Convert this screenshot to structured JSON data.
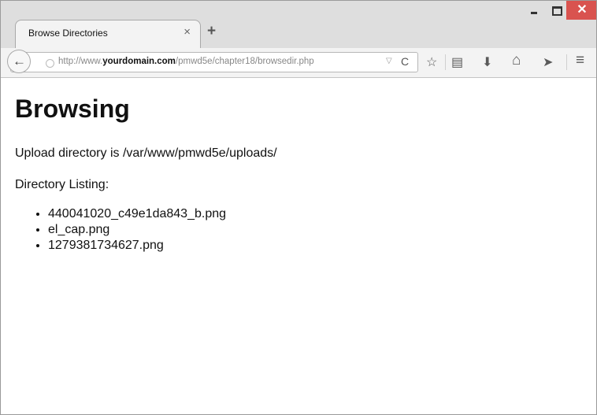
{
  "window": {
    "tab_title": "Browse Directories",
    "tab_close": "×",
    "new_tab": "+",
    "minimize": "–",
    "close": "✕"
  },
  "navbar": {
    "back_glyph": "←",
    "url_prefix": "http://www.",
    "url_domain": "yourdomain.com",
    "url_path": "/pmwd5e/chapter18/browsedir.php",
    "dropdown_glyph": "▽",
    "reload_glyph": "C",
    "icons": [
      "star-icon",
      "clipboard-icon",
      "download-icon",
      "home-icon",
      "share-icon",
      "menu-icon"
    ],
    "icon_glyphs": {
      "star": "☆",
      "clipboard": "▤",
      "download": "⬇",
      "home": "⌂",
      "share": "➤",
      "menu": "≡"
    }
  },
  "page": {
    "heading": "Browsing",
    "upload_line": "Upload directory is /var/www/pmwd5e/uploads/",
    "listing_label": "Directory Listing:",
    "files": [
      "440041020_c49e1da843_b.png",
      "el_cap.png",
      "1279381734627.png"
    ]
  }
}
